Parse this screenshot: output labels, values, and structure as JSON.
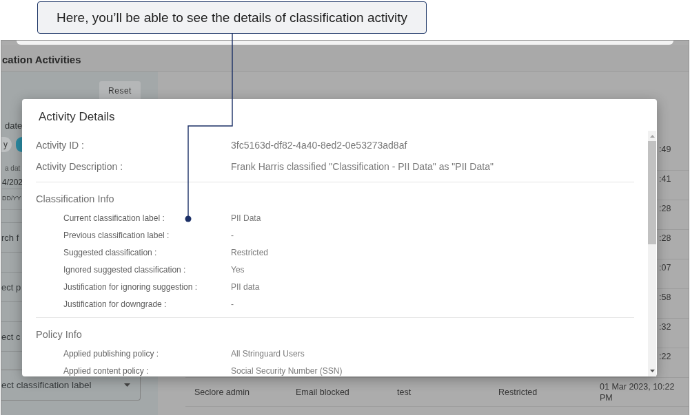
{
  "callout": {
    "text": "Here, you’ll be able to see the details of classification activity"
  },
  "app": {
    "title": "cation Activities",
    "filters": {
      "reset_button": "Reset",
      "date_label": "date",
      "date_chips": [
        {
          "label": "y",
          "selected": false
        },
        {
          "selected": true
        }
      ],
      "date_input": {
        "label": "a dat",
        "value": "4/202",
        "hint": "DD/YY"
      },
      "fields": [
        {
          "kind": "search",
          "placeholder": "rch f"
        },
        {
          "kind": "select",
          "placeholder": "ect p"
        },
        {
          "kind": "select",
          "placeholder": "ect c"
        },
        {
          "kind": "dropdown",
          "placeholder": "ect classification label"
        }
      ]
    },
    "table": {
      "rows": [
        {
          "kind": "covered",
          "column_5": ":49"
        },
        {
          "kind": "covered",
          "column_5": ":41"
        },
        {
          "kind": "covered",
          "column_5": ":28"
        },
        {
          "kind": "covered",
          "column_5": ":28"
        },
        {
          "kind": "covered",
          "column_5": ":07"
        },
        {
          "kind": "covered",
          "column_5": ":58"
        },
        {
          "kind": "covered",
          "column_5": ":32"
        },
        {
          "kind": "covered",
          "column_5": ":22"
        },
        {
          "kind": "full",
          "column_1": "Seclore admin",
          "column_2": "Email blocked",
          "column_3": "test",
          "column_4": "Restricted",
          "column_5": "01 Mar 2023, 10:22 PM"
        }
      ]
    }
  },
  "modal": {
    "title": "Activity Details",
    "fields": [
      {
        "label": "Activity ID :",
        "value": "3fc5163d-df82-4a40-8ed2-0e53273ad8af"
      },
      {
        "label": "Activity Description :",
        "value": "Frank Harris classified \"Classification - PII Data\" as \"PII Data\""
      }
    ],
    "sections": [
      {
        "title": "Classification Info",
        "rows": [
          {
            "label": "Current classification label :",
            "value": "PII Data"
          },
          {
            "label": "Previous classification label :",
            "value": "-"
          },
          {
            "label": "Suggested classification :",
            "value": "Restricted"
          },
          {
            "label": "Ignored suggested classification :",
            "value": "Yes"
          },
          {
            "label": "Justification for ignoring suggestion :",
            "value": "PII data"
          },
          {
            "label": "Justification for downgrade :",
            "value": "-"
          }
        ]
      },
      {
        "title": "Policy Info",
        "rows": [
          {
            "label": "Applied publishing policy :",
            "value": "All Stringuard Users"
          },
          {
            "label": "Applied content policy :",
            "value": "Social Security Number (SSN)"
          }
        ]
      }
    ]
  }
}
